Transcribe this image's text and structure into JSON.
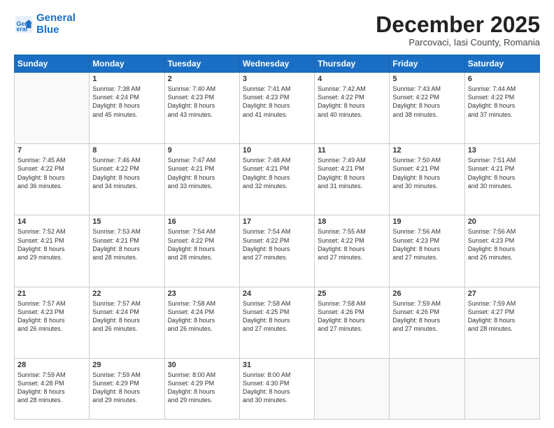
{
  "header": {
    "logo_line1": "General",
    "logo_line2": "Blue",
    "month": "December 2025",
    "location": "Parcovaci, Iasi County, Romania"
  },
  "weekdays": [
    "Sunday",
    "Monday",
    "Tuesday",
    "Wednesday",
    "Thursday",
    "Friday",
    "Saturday"
  ],
  "weeks": [
    [
      {
        "day": "",
        "content": ""
      },
      {
        "day": "1",
        "content": "Sunrise: 7:38 AM\nSunset: 4:24 PM\nDaylight: 8 hours\nand 45 minutes."
      },
      {
        "day": "2",
        "content": "Sunrise: 7:40 AM\nSunset: 4:23 PM\nDaylight: 8 hours\nand 43 minutes."
      },
      {
        "day": "3",
        "content": "Sunrise: 7:41 AM\nSunset: 4:23 PM\nDaylight: 8 hours\nand 41 minutes."
      },
      {
        "day": "4",
        "content": "Sunrise: 7:42 AM\nSunset: 4:22 PM\nDaylight: 8 hours\nand 40 minutes."
      },
      {
        "day": "5",
        "content": "Sunrise: 7:43 AM\nSunset: 4:22 PM\nDaylight: 8 hours\nand 38 minutes."
      },
      {
        "day": "6",
        "content": "Sunrise: 7:44 AM\nSunset: 4:22 PM\nDaylight: 8 hours\nand 37 minutes."
      }
    ],
    [
      {
        "day": "7",
        "content": "Sunrise: 7:45 AM\nSunset: 4:22 PM\nDaylight: 8 hours\nand 36 minutes."
      },
      {
        "day": "8",
        "content": "Sunrise: 7:46 AM\nSunset: 4:22 PM\nDaylight: 8 hours\nand 34 minutes."
      },
      {
        "day": "9",
        "content": "Sunrise: 7:47 AM\nSunset: 4:21 PM\nDaylight: 8 hours\nand 33 minutes."
      },
      {
        "day": "10",
        "content": "Sunrise: 7:48 AM\nSunset: 4:21 PM\nDaylight: 8 hours\nand 32 minutes."
      },
      {
        "day": "11",
        "content": "Sunrise: 7:49 AM\nSunset: 4:21 PM\nDaylight: 8 hours\nand 31 minutes."
      },
      {
        "day": "12",
        "content": "Sunrise: 7:50 AM\nSunset: 4:21 PM\nDaylight: 8 hours\nand 30 minutes."
      },
      {
        "day": "13",
        "content": "Sunrise: 7:51 AM\nSunset: 4:21 PM\nDaylight: 8 hours\nand 30 minutes."
      }
    ],
    [
      {
        "day": "14",
        "content": "Sunrise: 7:52 AM\nSunset: 4:21 PM\nDaylight: 8 hours\nand 29 minutes."
      },
      {
        "day": "15",
        "content": "Sunrise: 7:53 AM\nSunset: 4:21 PM\nDaylight: 8 hours\nand 28 minutes."
      },
      {
        "day": "16",
        "content": "Sunrise: 7:54 AM\nSunset: 4:22 PM\nDaylight: 8 hours\nand 28 minutes."
      },
      {
        "day": "17",
        "content": "Sunrise: 7:54 AM\nSunset: 4:22 PM\nDaylight: 8 hours\nand 27 minutes."
      },
      {
        "day": "18",
        "content": "Sunrise: 7:55 AM\nSunset: 4:22 PM\nDaylight: 8 hours\nand 27 minutes."
      },
      {
        "day": "19",
        "content": "Sunrise: 7:56 AM\nSunset: 4:23 PM\nDaylight: 8 hours\nand 27 minutes."
      },
      {
        "day": "20",
        "content": "Sunrise: 7:56 AM\nSunset: 4:23 PM\nDaylight: 8 hours\nand 26 minutes."
      }
    ],
    [
      {
        "day": "21",
        "content": "Sunrise: 7:57 AM\nSunset: 4:23 PM\nDaylight: 8 hours\nand 26 minutes."
      },
      {
        "day": "22",
        "content": "Sunrise: 7:57 AM\nSunset: 4:24 PM\nDaylight: 8 hours\nand 26 minutes."
      },
      {
        "day": "23",
        "content": "Sunrise: 7:58 AM\nSunset: 4:24 PM\nDaylight: 8 hours\nand 26 minutes."
      },
      {
        "day": "24",
        "content": "Sunrise: 7:58 AM\nSunset: 4:25 PM\nDaylight: 8 hours\nand 27 minutes."
      },
      {
        "day": "25",
        "content": "Sunrise: 7:58 AM\nSunset: 4:26 PM\nDaylight: 8 hours\nand 27 minutes."
      },
      {
        "day": "26",
        "content": "Sunrise: 7:59 AM\nSunset: 4:26 PM\nDaylight: 8 hours\nand 27 minutes."
      },
      {
        "day": "27",
        "content": "Sunrise: 7:59 AM\nSunset: 4:27 PM\nDaylight: 8 hours\nand 28 minutes."
      }
    ],
    [
      {
        "day": "28",
        "content": "Sunrise: 7:59 AM\nSunset: 4:28 PM\nDaylight: 8 hours\nand 28 minutes."
      },
      {
        "day": "29",
        "content": "Sunrise: 7:59 AM\nSunset: 4:29 PM\nDaylight: 8 hours\nand 29 minutes."
      },
      {
        "day": "30",
        "content": "Sunrise: 8:00 AM\nSunset: 4:29 PM\nDaylight: 8 hours\nand 29 minutes."
      },
      {
        "day": "31",
        "content": "Sunrise: 8:00 AM\nSunset: 4:30 PM\nDaylight: 8 hours\nand 30 minutes."
      },
      {
        "day": "",
        "content": ""
      },
      {
        "day": "",
        "content": ""
      },
      {
        "day": "",
        "content": ""
      }
    ]
  ]
}
